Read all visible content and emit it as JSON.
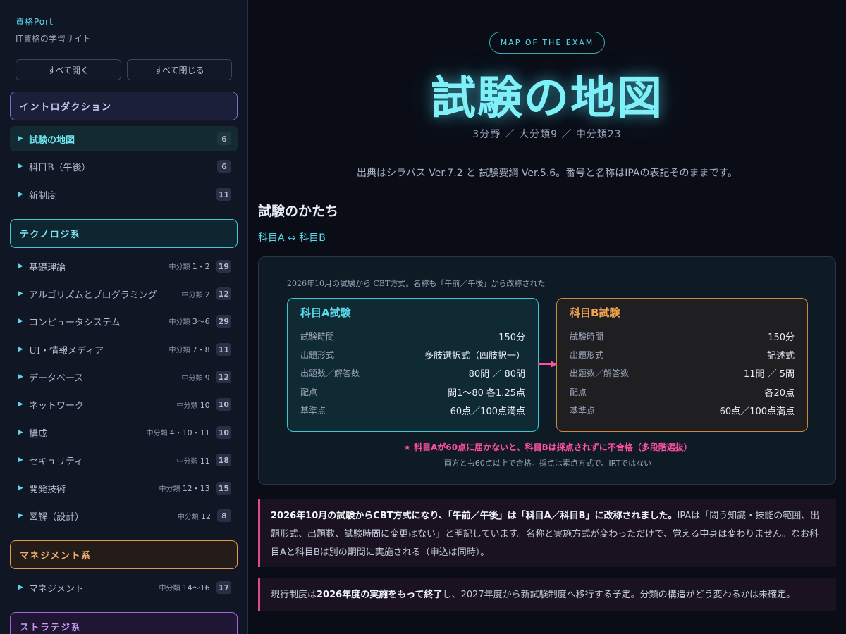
{
  "sidebar": {
    "brand": "資格Port",
    "tagline": "IT資格の学習サイト",
    "expand_all": "すべて開く",
    "collapse_all": "すべて閉じる",
    "sections": {
      "intro": "イントロダクション",
      "tech": "テクノロジ系",
      "mgmt": "マネジメント系",
      "strat": "ストラテジ系"
    },
    "intro_items": [
      {
        "label": "試験の地図",
        "count": "6"
      },
      {
        "label": "科目B（午後）",
        "count": "6"
      },
      {
        "label": "新制度",
        "count": "11"
      }
    ],
    "tech_items": [
      {
        "label": "基礎理論",
        "sub_prefix": "中分類",
        "sub_nums": "1・2",
        "count": "19"
      },
      {
        "label": "アルゴリズムとプログラミング",
        "sub_prefix": "中分類",
        "sub_nums": "2",
        "count": "12"
      },
      {
        "label": "コンピュータシステム",
        "sub_prefix": "中分類",
        "sub_nums": "3〜6",
        "count": "29"
      },
      {
        "label": "UI・情報メディア",
        "sub_prefix": "中分類",
        "sub_nums": "7・8",
        "count": "11"
      },
      {
        "label": "データベース",
        "sub_prefix": "中分類",
        "sub_nums": "9",
        "count": "12"
      },
      {
        "label": "ネットワーク",
        "sub_prefix": "中分類",
        "sub_nums": "10",
        "count": "10"
      },
      {
        "label": "構成",
        "sub_prefix": "中分類",
        "sub_nums": "4・10・11",
        "count": "10"
      },
      {
        "label": "セキュリティ",
        "sub_prefix": "中分類",
        "sub_nums": "11",
        "count": "18"
      },
      {
        "label": "開発技術",
        "sub_prefix": "中分類",
        "sub_nums": "12・13",
        "count": "15"
      },
      {
        "label": "図解（設計）",
        "sub_prefix": "中分類",
        "sub_nums": "12",
        "count": "8"
      }
    ],
    "mgmt_items": [
      {
        "label": "マネジメント",
        "sub_prefix": "中分類",
        "sub_nums": "14〜16",
        "count": "17"
      }
    ]
  },
  "hero": {
    "pill": "MAP OF THE EXAM",
    "title": "試験の地図",
    "stats": "3分野 ／ 大分類9 ／ 中分類23",
    "source": "出典はシラバス Ver.7.2 と 試験要綱 Ver.5.6。番号と名称はIPAの表記そのままです。"
  },
  "exam": {
    "heading": "試験のかたち",
    "sub_link": "科目A ⇔ 科目B",
    "caption": "2026年10月の試験から CBT方式。名称も「午前／午後」から改称された",
    "card_a": {
      "title": "科目A試験",
      "rows": [
        {
          "k": "試験時間",
          "v": "150分"
        },
        {
          "k": "出題形式",
          "v": "多肢選択式（四肢択一）"
        },
        {
          "k": "出題数／解答数",
          "v": "80問 ／ 80問"
        },
        {
          "k": "配点",
          "v": "問1〜80 各1.25点"
        },
        {
          "k": "基準点",
          "v": "60点／100点満点"
        }
      ]
    },
    "card_b": {
      "title": "科目B試験",
      "rows": [
        {
          "k": "試験時間",
          "v": "150分"
        },
        {
          "k": "出題形式",
          "v": "記述式"
        },
        {
          "k": "出題数／解答数",
          "v": "11問 ／ 5問"
        },
        {
          "k": "配点",
          "v": "各20点"
        },
        {
          "k": "基準点",
          "v": "60点／100点満点"
        }
      ]
    },
    "warning": "★ 科目Aが60点に届かないと、科目Bは採点されずに不合格（多段階選抜）",
    "pass_note": "両方とも60点以上で合格。採点は素点方式で、IRTではない"
  },
  "notes": {
    "note1_bold": "2026年10月の試験からCBT方式になり、「午前／午後」は「科目A／科目B」に改称されました。",
    "note1_rest": "IPAは「問う知識・技能の範囲、出題形式、出題数、試験時間に変更はない」と明記しています。名称と実施方式が変わっただけで、覚える中身は変わりません。なお科目Aと科目Bは別の期間に実施される（申込は同時）。",
    "note2_pre": "現行制度は",
    "note2_bold": "2026年度の実施をもって終了",
    "note2_post": "し、2027年度から新試験制度へ移行する予定。分類の構造がどう変わるかは未確定。"
  },
  "colors": {
    "accent_cyan": "#5ad8ea",
    "accent_orange": "#f0a24e",
    "accent_pink": "#ff4fa3",
    "accent_purple": "#a860e0"
  }
}
